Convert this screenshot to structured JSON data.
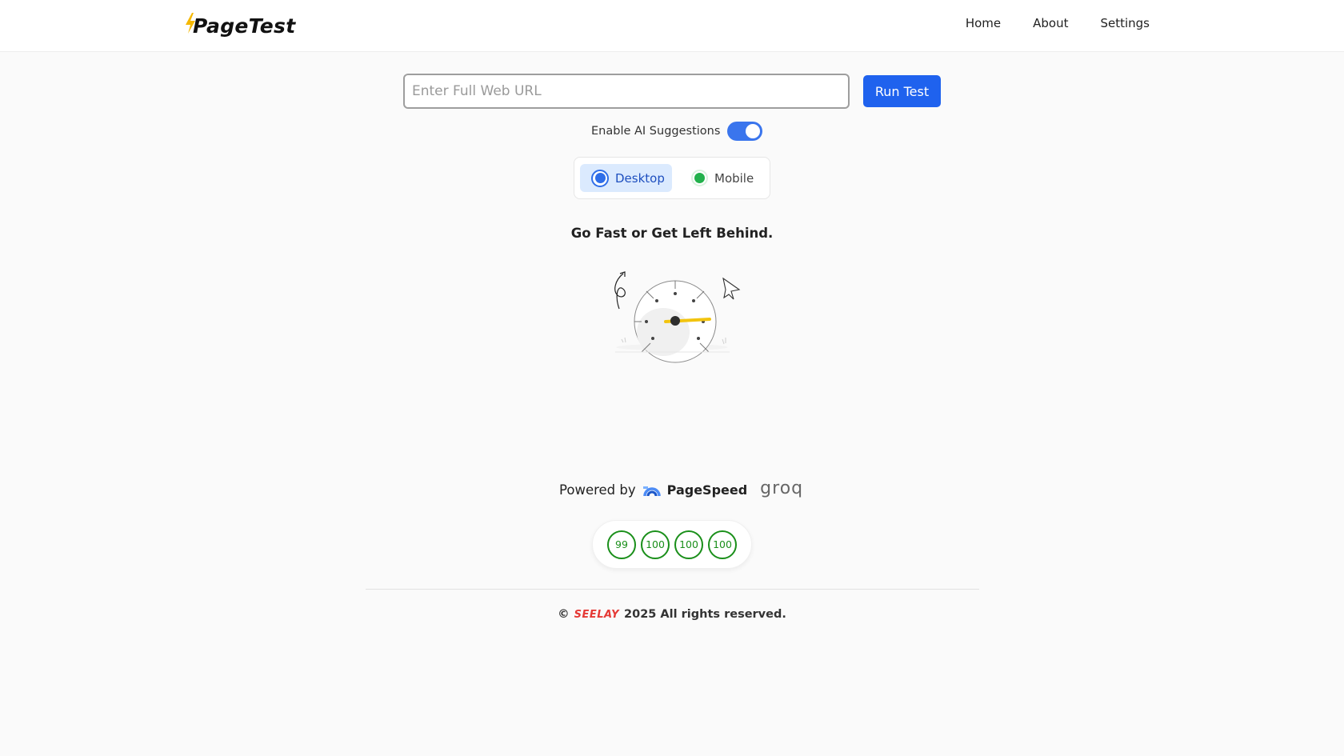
{
  "header": {
    "logo_text": "PageTest",
    "nav": {
      "home": "Home",
      "about": "About",
      "settings": "Settings"
    }
  },
  "form": {
    "url_placeholder": "Enter Full Web URL",
    "url_value": "",
    "run_label": "Run Test"
  },
  "ai": {
    "label": "Enable AI Suggestions",
    "enabled": true
  },
  "device": {
    "desktop": "Desktop",
    "mobile": "Mobile",
    "selected": "Desktop"
  },
  "tagline": "Go Fast or Get Left Behind.",
  "powered": {
    "label": "Powered by",
    "pagespeed": "PageSpeed",
    "groq": "groq"
  },
  "scores": [
    "99",
    "100",
    "100",
    "100"
  ],
  "footer": {
    "copyright": "©",
    "brand": "SEELAY",
    "text": "2025 All rights reserved."
  },
  "colors": {
    "accent": "#1f62ee",
    "score": "#1a8f1a",
    "mobile_radio": "#22b14c",
    "bolt": "#f5b800",
    "brand": "#e53935"
  }
}
